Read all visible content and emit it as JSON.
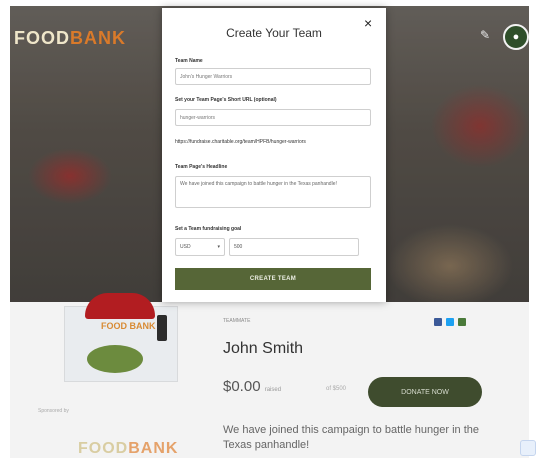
{
  "background": {
    "logo_part1": "FOOD",
    "logo_part2": "BANK",
    "avatar_initial": "●",
    "card_logo": "FOOD BANK",
    "small_label": "TEAMMATE",
    "name": "John Smith",
    "amount": "$0.00",
    "amount_suffix": "raised",
    "goal_label": "of $500",
    "donate_label": "DONATE NOW",
    "description": "We have joined this campaign to battle hunger in the Texas panhandle!",
    "left_label": "Sponsored by",
    "bottom_logo_part1": "FOOD",
    "bottom_logo_part2": "BANK"
  },
  "modal": {
    "title": "Create Your Team",
    "close_label": "×",
    "team_name_label": "Team Name",
    "team_name_value": "John's Hunger Warriors",
    "url_label": "Set your Team Page's Short URL (optional)",
    "url_value": "hunger-warriors",
    "url_preview": "https://fundraise.charitable.org/team/HPFB/hunger-warriors",
    "headline_label": "Team Page's Headline",
    "headline_value": "We have joined this campaign to battle hunger in the Texas panhandle!",
    "goal_label": "Set a Team fundraising goal",
    "currency": "USD",
    "goal_value": "500",
    "create_button": "CREATE TEAM"
  },
  "colors": {
    "accent": "#566637",
    "donate_bg": "#3f4c2e"
  }
}
